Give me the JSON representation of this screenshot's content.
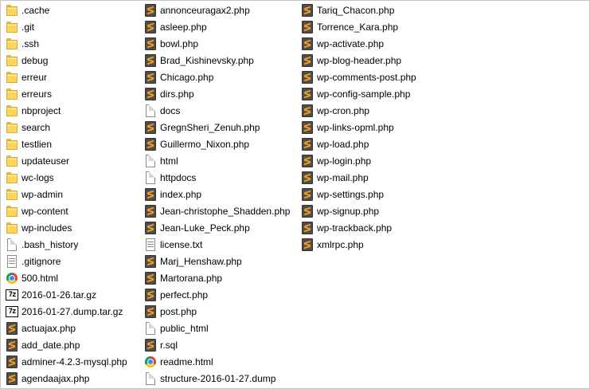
{
  "columns": [
    {
      "items": [
        {
          "name": ".cache",
          "type": "folder"
        },
        {
          "name": ".git",
          "type": "folder"
        },
        {
          "name": ".ssh",
          "type": "folder"
        },
        {
          "name": "debug",
          "type": "folder"
        },
        {
          "name": "erreur",
          "type": "folder"
        },
        {
          "name": "erreurs",
          "type": "folder"
        },
        {
          "name": "nbproject",
          "type": "folder"
        },
        {
          "name": "search",
          "type": "folder"
        },
        {
          "name": "testlien",
          "type": "folder"
        },
        {
          "name": "updateuser",
          "type": "folder"
        },
        {
          "name": "wc-logs",
          "type": "folder"
        },
        {
          "name": "wp-admin",
          "type": "folder"
        },
        {
          "name": "wp-content",
          "type": "folder"
        },
        {
          "name": "wp-includes",
          "type": "folder"
        },
        {
          "name": ".bash_history",
          "type": "doc"
        },
        {
          "name": ".gitignore",
          "type": "txt"
        },
        {
          "name": "500.html",
          "type": "chrome"
        },
        {
          "name": "2016-01-26.tar.gz",
          "type": "7z"
        },
        {
          "name": "2016-01-27.dump.tar.gz",
          "type": "7z"
        },
        {
          "name": "actuajax.php",
          "type": "php"
        },
        {
          "name": "add_date.php",
          "type": "php"
        },
        {
          "name": "adminer-4.2.3-mysql.php",
          "type": "php"
        },
        {
          "name": "agendaajax.php",
          "type": "php"
        }
      ]
    },
    {
      "items": [
        {
          "name": "annonceuragax2.php",
          "type": "php"
        },
        {
          "name": "asleep.php",
          "type": "php"
        },
        {
          "name": "bowl.php",
          "type": "php"
        },
        {
          "name": "Brad_Kishinevsky.php",
          "type": "php"
        },
        {
          "name": "Chicago.php",
          "type": "php"
        },
        {
          "name": "dirs.php",
          "type": "php"
        },
        {
          "name": "docs",
          "type": "doc"
        },
        {
          "name": "GregnSheri_Zenuh.php",
          "type": "php"
        },
        {
          "name": "Guillermo_Nixon.php",
          "type": "php"
        },
        {
          "name": "html",
          "type": "doc"
        },
        {
          "name": "httpdocs",
          "type": "doc"
        },
        {
          "name": "index.php",
          "type": "php"
        },
        {
          "name": "Jean-christophe_Shadden.php",
          "type": "php"
        },
        {
          "name": "Jean-Luke_Peck.php",
          "type": "php"
        },
        {
          "name": "license.txt",
          "type": "txt"
        },
        {
          "name": "Marj_Henshaw.php",
          "type": "php"
        },
        {
          "name": "Martorana.php",
          "type": "php"
        },
        {
          "name": "perfect.php",
          "type": "php"
        },
        {
          "name": "post.php",
          "type": "php"
        },
        {
          "name": "public_html",
          "type": "doc"
        },
        {
          "name": "r.sql",
          "type": "php"
        },
        {
          "name": "readme.html",
          "type": "chrome"
        },
        {
          "name": "structure-2016-01-27.dump",
          "type": "doc"
        }
      ]
    },
    {
      "items": [
        {
          "name": "Tariq_Chacon.php",
          "type": "php"
        },
        {
          "name": "Torrence_Kara.php",
          "type": "php"
        },
        {
          "name": "wp-activate.php",
          "type": "php"
        },
        {
          "name": "wp-blog-header.php",
          "type": "php"
        },
        {
          "name": "wp-comments-post.php",
          "type": "php"
        },
        {
          "name": "wp-config-sample.php",
          "type": "php"
        },
        {
          "name": "wp-cron.php",
          "type": "php"
        },
        {
          "name": "wp-links-opml.php",
          "type": "php"
        },
        {
          "name": "wp-load.php",
          "type": "php"
        },
        {
          "name": "wp-login.php",
          "type": "php"
        },
        {
          "name": "wp-mail.php",
          "type": "php"
        },
        {
          "name": "wp-settings.php",
          "type": "php"
        },
        {
          "name": "wp-signup.php",
          "type": "php"
        },
        {
          "name": "wp-trackback.php",
          "type": "php"
        },
        {
          "name": "xmlrpc.php",
          "type": "php"
        }
      ]
    }
  ],
  "icon_names": {
    "folder": "folder-icon",
    "php": "sublime-text-file-icon",
    "doc": "blank-file-icon",
    "txt": "text-file-icon",
    "chrome": "chrome-html-file-icon",
    "7z": "7zip-archive-icon"
  },
  "colors": {
    "folder": "#ffd65c",
    "php_bg": "#4d4d4d",
    "php_accent": "#f59b1c",
    "border": "#c7c7c7"
  }
}
